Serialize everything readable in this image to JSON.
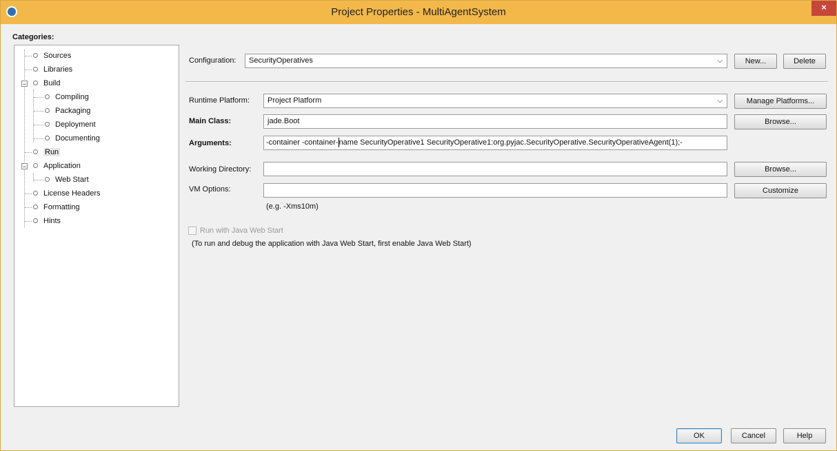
{
  "window": {
    "title": "Project Properties - MultiAgentSystem",
    "close_label": "×"
  },
  "categories": {
    "label": "Categories:",
    "items": [
      {
        "label": "Sources"
      },
      {
        "label": "Libraries"
      },
      {
        "label": "Build"
      },
      {
        "label": "Compiling"
      },
      {
        "label": "Packaging"
      },
      {
        "label": "Deployment"
      },
      {
        "label": "Documenting"
      },
      {
        "label": "Run",
        "selected": true
      },
      {
        "label": "Application"
      },
      {
        "label": "Web Start"
      },
      {
        "label": "License Headers"
      },
      {
        "label": "Formatting"
      },
      {
        "label": "Hints"
      }
    ]
  },
  "configuration": {
    "label": "Configuration:",
    "value": "SecurityOperatives",
    "new_label": "New...",
    "delete_label": "Delete"
  },
  "runtime_platform": {
    "label": "Runtime Platform:",
    "value": "Project Platform",
    "manage_label": "Manage Platforms..."
  },
  "main_class": {
    "label": "Main Class:",
    "value": "jade.Boot",
    "browse_label": "Browse..."
  },
  "arguments": {
    "label": "Arguments:",
    "value_before_caret": "-container -container-",
    "value_after_caret": "name SecurityOperative1  SecurityOperative1:org.pyjac.SecurityOperative.SecurityOperativeAgent(1);-"
  },
  "working_directory": {
    "label": "Working Directory:",
    "value": "",
    "browse_label": "Browse..."
  },
  "vm_options": {
    "label": "VM Options:",
    "value": "",
    "customize_label": "Customize",
    "hint": "(e.g. -Xms10m)"
  },
  "web_start": {
    "label": "Run with Java Web Start",
    "checked": false,
    "note": "(To run and debug the application with Java Web Start, first enable Java Web Start)"
  },
  "footer": {
    "ok_label": "OK",
    "cancel_label": "Cancel",
    "help_label": "Help"
  },
  "colors": {
    "titlebar": "#f2b84a",
    "close": "#c7463a",
    "default_button_border": "#3c7fb1"
  },
  "icons": {
    "app": "netbeans-project-icon",
    "tree_node": "circle-icon",
    "expander": "minus-icon"
  }
}
